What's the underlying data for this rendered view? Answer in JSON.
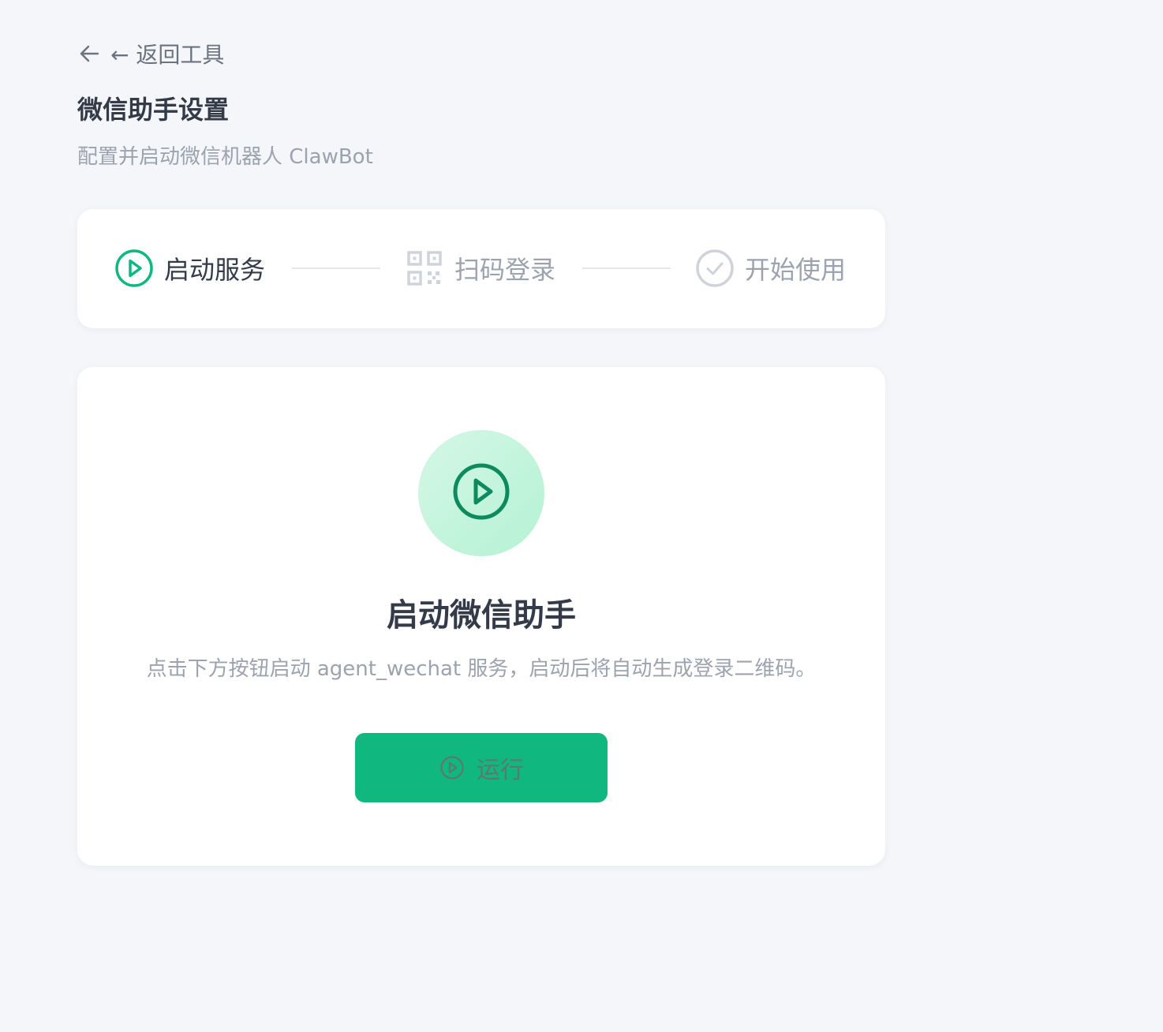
{
  "header": {
    "back_label": "← 返回工具",
    "title": "微信助手设置",
    "subtitle": "配置并启动微信机器人 ClawBot"
  },
  "steps": [
    {
      "label": "启动服务",
      "icon": "play-circle-icon",
      "state": "active"
    },
    {
      "label": "扫码登录",
      "icon": "qr-code-icon",
      "state": "inactive"
    },
    {
      "label": "开始使用",
      "icon": "check-circle-icon",
      "state": "inactive"
    }
  ],
  "main": {
    "icon": "play-circle-icon",
    "title": "启动微信助手",
    "description": "点击下方按钮启动 agent_wechat 服务，启动后将自动生成登录二维码。",
    "run_button_label": "运行",
    "run_button_icon": "play-circle-icon"
  },
  "colors": {
    "background": "#f4f6fa",
    "accent": "#10b77f",
    "accent_dark": "#0e8a5f",
    "text_primary": "#343b48",
    "text_muted": "#9ca3af",
    "inactive_icon": "#cfd3da"
  }
}
